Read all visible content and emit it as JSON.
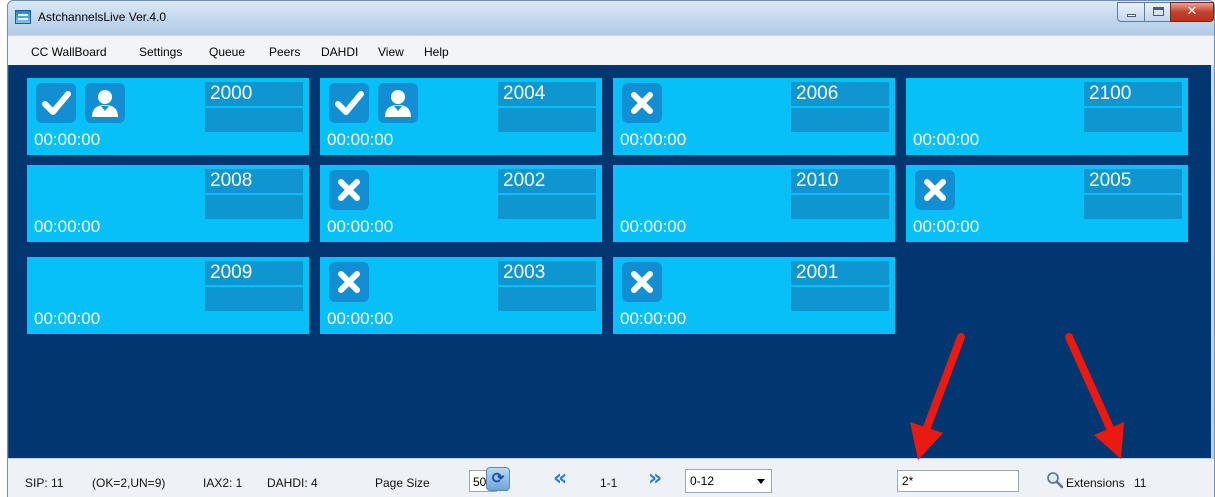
{
  "window": {
    "title": "AstchannelsLive Ver.4.0"
  },
  "menu": [
    "CC WallBoard",
    "Settings",
    "Queue",
    "Peers",
    "DAHDI",
    "View",
    "Help"
  ],
  "tiles": [
    {
      "ext": "2000",
      "time": "00:00:00",
      "icons": [
        "check-icon",
        "user-icon"
      ]
    },
    {
      "ext": "2004",
      "time": "00:00:00",
      "icons": [
        "check-icon",
        "user-icon"
      ]
    },
    {
      "ext": "2006",
      "time": "00:00:00",
      "icons": [
        "x-icon"
      ]
    },
    {
      "ext": "2100",
      "time": "00:00:00",
      "icons": []
    },
    {
      "ext": "2008",
      "time": "00:00:00",
      "icons": []
    },
    {
      "ext": "2002",
      "time": "00:00:00",
      "icons": [
        "x-icon"
      ]
    },
    {
      "ext": "2010",
      "time": "00:00:00",
      "icons": []
    },
    {
      "ext": "2005",
      "time": "00:00:00",
      "icons": [
        "x-icon"
      ]
    },
    {
      "ext": "2009",
      "time": "00:00:00",
      "icons": []
    },
    {
      "ext": "2003",
      "time": "00:00:00",
      "icons": [
        "x-icon"
      ]
    },
    {
      "ext": "2001",
      "time": "00:00:00",
      "icons": [
        "x-icon"
      ]
    }
  ],
  "status": {
    "sip": "SIP: 11",
    "sip_detail": "(OK=2,UN=9)",
    "iax2": "IAX2: 1",
    "dahdi": "DAHDI: 4",
    "page_size_label": "Page Size",
    "page_size_value": "50",
    "page_range": "1-1",
    "range_select": "0-12",
    "search_value": "2*",
    "extensions_label": "Extensions",
    "extensions_count": "11"
  },
  "colors": {
    "content_bg": "#003770",
    "tile_bg": "#07c0f7",
    "tile_block": "#0f95cf",
    "annotation_arrow": "#e81a12"
  }
}
